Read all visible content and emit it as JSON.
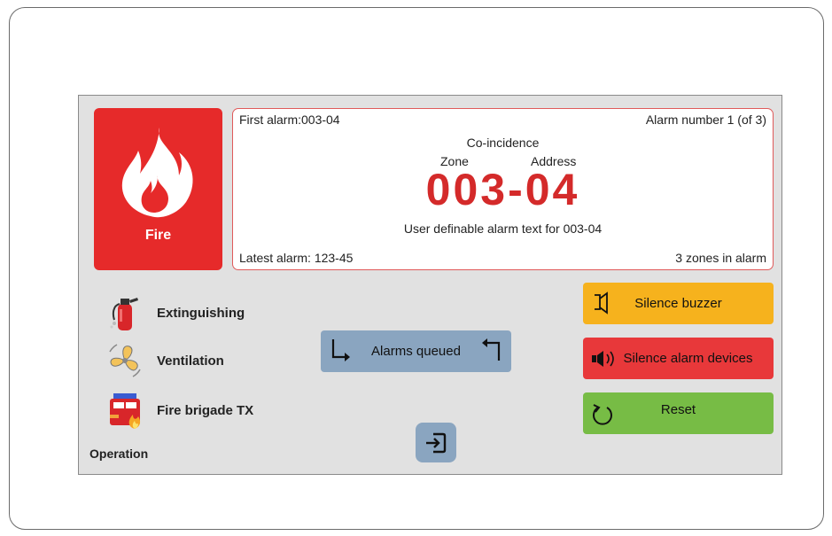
{
  "fire_tile": {
    "label": "Fire",
    "color": "#e62a2a"
  },
  "alarm": {
    "first_alarm": "First alarm:003-04",
    "alarm_number": "Alarm number 1 (of 3)",
    "mode": "Co-incidence",
    "zone_label": "Zone",
    "address_label": "Address",
    "code": "003-04",
    "user_text": "User definable alarm text for 003-04",
    "latest_alarm": "Latest alarm: 123-45",
    "zones_in_alarm": "3 zones in alarm",
    "code_color": "#d42a2a"
  },
  "status": [
    {
      "label": "Extinguishing",
      "icon": "fire-extinguisher-icon"
    },
    {
      "label": "Ventilation",
      "icon": "fan-icon"
    },
    {
      "label": "Fire brigade TX",
      "icon": "fire-truck-icon"
    }
  ],
  "operation_label": "Operation",
  "queued": {
    "label": "Alarms queued"
  },
  "actions": {
    "silence_buzzer": {
      "label": "Silence buzzer",
      "icon": "buzzer-icon",
      "color": "#f6b21d"
    },
    "silence_devices": {
      "label": "Silence alarm devices",
      "icon": "speaker-icon",
      "color": "#e8383a"
    },
    "reset": {
      "label": "Reset",
      "icon": "reset-icon",
      "color": "#77bc45"
    }
  },
  "exit": {
    "icon": "exit-icon"
  }
}
